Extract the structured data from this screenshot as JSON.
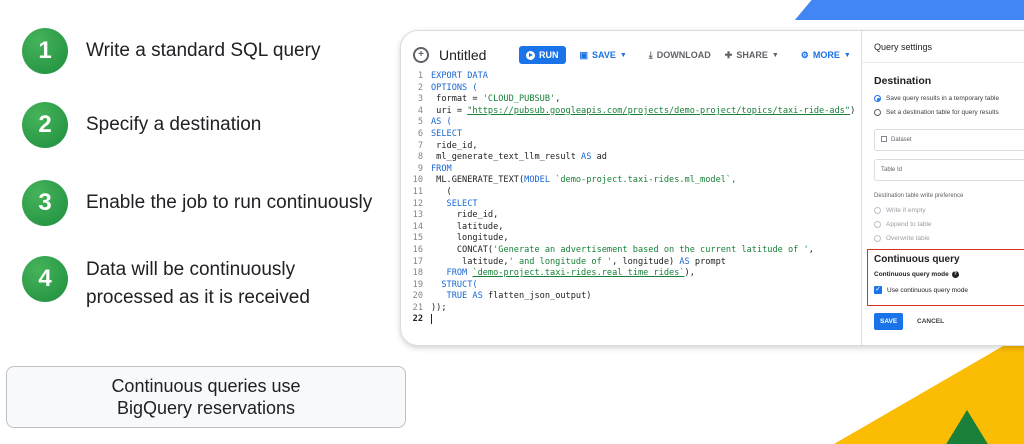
{
  "steps": [
    {
      "num": "1",
      "text": "Write a standard SQL query"
    },
    {
      "num": "2",
      "text": "Specify a destination"
    },
    {
      "num": "3",
      "text": "Enable the job to run continuously"
    },
    {
      "num": "4",
      "line1": "Data will be continuously",
      "line2": "processed as it is received"
    }
  ],
  "note": {
    "line1": "Continuous queries use",
    "line2": "BigQuery reservations"
  },
  "toolbar": {
    "title": "Untitled",
    "run": "RUN",
    "save": "SAVE",
    "download": "DOWNLOAD",
    "share": "SHARE",
    "more": "MORE"
  },
  "code": {
    "l1": "EXPORT DATA",
    "l2": "OPTIONS (",
    "l3a": " format = ",
    "l3b": "'CLOUD_PUBSUB'",
    "l3c": ",",
    "l4a": " uri = ",
    "l4b": "\"https://pubsub.googleapis.com/projects/demo-project/topics/taxi-ride-ads\"",
    "l4c": ")",
    "l5": "AS (",
    "l6": "SELECT",
    "l7": " ride_id,",
    "l8a": " ml_generate_text_llm_result ",
    "l8b": "AS",
    "l8c": " ad",
    "l9": "FROM",
    "l10a": " ML.GENERATE_TEXT(",
    "l10b": "MODEL",
    "l10c": " `demo-project.taxi-rides.ml_model`,",
    "l11": "   (",
    "l12": "   SELECT",
    "l13": "     ride_id,",
    "l14": "     latitude,",
    "l15": "     longitude,",
    "l16a": "     CONCAT(",
    "l16b": "'Generate an advertisement based on the current latitude of '",
    "l16c": ",",
    "l17a": "      latitude,",
    "l17b": "' and longitude of '",
    "l17c": ", longitude) ",
    "l17d": "AS",
    "l17e": " prompt",
    "l18a": "   FROM ",
    "l18b": "`demo-project.taxi-rides.real_time_rides`",
    "l18c": "),",
    "l19": "  STRUCT(",
    "l20a": "   TRUE ",
    "l20b": "AS",
    "l20c": " flatten_json_output)",
    "l21": "));"
  },
  "panel": {
    "header": "Query settings",
    "destination": "Destination",
    "opt_temp": "Save query results in a temporary table",
    "opt_dest": "Set a destination table for query results",
    "dataset": "Dataset",
    "table_id": "Table Id",
    "write_pref": "Destination table write preference",
    "write_empty": "Write if empty",
    "append": "Append to table",
    "overwrite": "Overwrite table",
    "cq_title": "Continuous query",
    "cq_mode": "Continuous query mode",
    "cq_check": "Use continuous query mode",
    "save": "SAVE",
    "cancel": "CANCEL"
  }
}
